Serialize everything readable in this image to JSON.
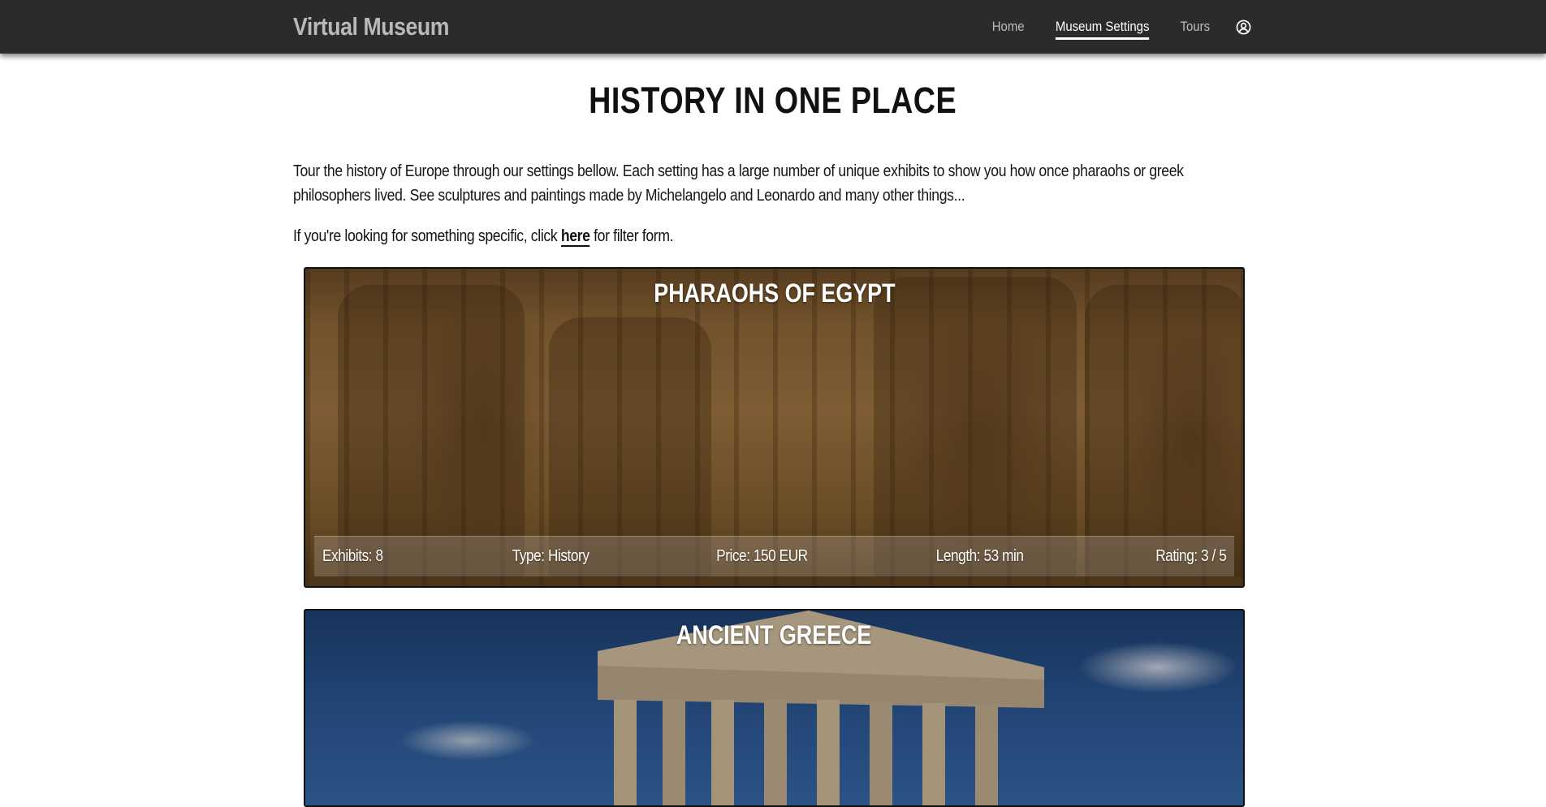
{
  "navbar": {
    "brand": "Virtual Museum",
    "links": [
      {
        "label": "Home"
      },
      {
        "label": "Museum Settings"
      },
      {
        "label": "Tours"
      }
    ],
    "user_icon": "user-circle-icon"
  },
  "main": {
    "title": "HISTORY IN ONE PLACE",
    "intro": "Tour the history of Europe through our settings bellow. Each setting has a large number of unique exhibits to show you how once pharaohs or greek philosophers lived. See sculptures and paintings made by Michelangelo and Leonardo and many other things...",
    "filter_prefix": "If you're looking for something specific, click ",
    "filter_link": "here",
    "filter_suffix": " for filter form."
  },
  "settings": [
    {
      "title": "PHARAOHS OF EGYPT",
      "exhibits": "Exhibits: 8",
      "type": "Type: History",
      "price": "Price: 150 EUR",
      "length": "Length: 53 min",
      "rating": "Rating: 3 / 5"
    },
    {
      "title": "ANCIENT GREECE"
    }
  ],
  "colors": {
    "navbar_bg": "#2b2b2b",
    "brand_text": "#b9b9b9",
    "nav_active": "#ffffff",
    "nav_inactive": "#bdbdbd"
  }
}
